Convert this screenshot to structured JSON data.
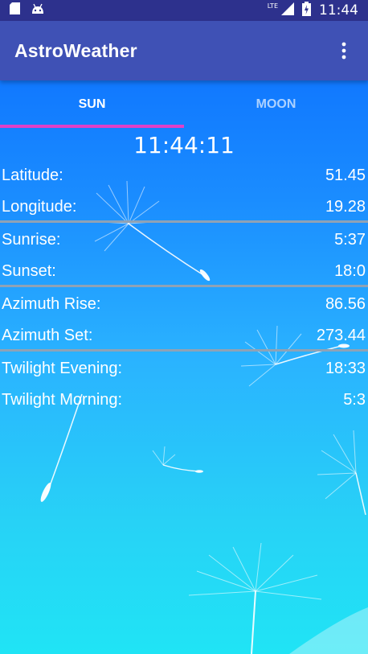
{
  "status_bar": {
    "time": "11:44",
    "network": "LTE",
    "icons": [
      "sd-card-icon",
      "android-icon",
      "signal-icon",
      "battery-charging-icon"
    ]
  },
  "app_bar": {
    "title": "AstroWeather",
    "menu_icon": "more-vert-icon"
  },
  "tabs": [
    {
      "label": "SUN",
      "selected": true
    },
    {
      "label": "MOON",
      "selected": false
    }
  ],
  "clock": "11:44:11",
  "rows": [
    {
      "label": "Latitude:",
      "value": "51.45"
    },
    {
      "label": "Longitude:",
      "value": "19.28"
    },
    {
      "label": "Sunrise:",
      "value": "5:37"
    },
    {
      "label": "Sunset:",
      "value": "18:0"
    },
    {
      "label": "Azimuth Rise:",
      "value": "86.56"
    },
    {
      "label": "Azimuth Set:",
      "value": "273.44"
    },
    {
      "label": "Twilight Evening:",
      "value": "18:33"
    },
    {
      "label": "Twilight Morning:",
      "value": "5:3"
    }
  ],
  "colors": {
    "status_bar": "#2d318d",
    "app_bar": "#3f51b5",
    "tab_indicator": "#e040c8",
    "divider": "#8fa2b5"
  }
}
